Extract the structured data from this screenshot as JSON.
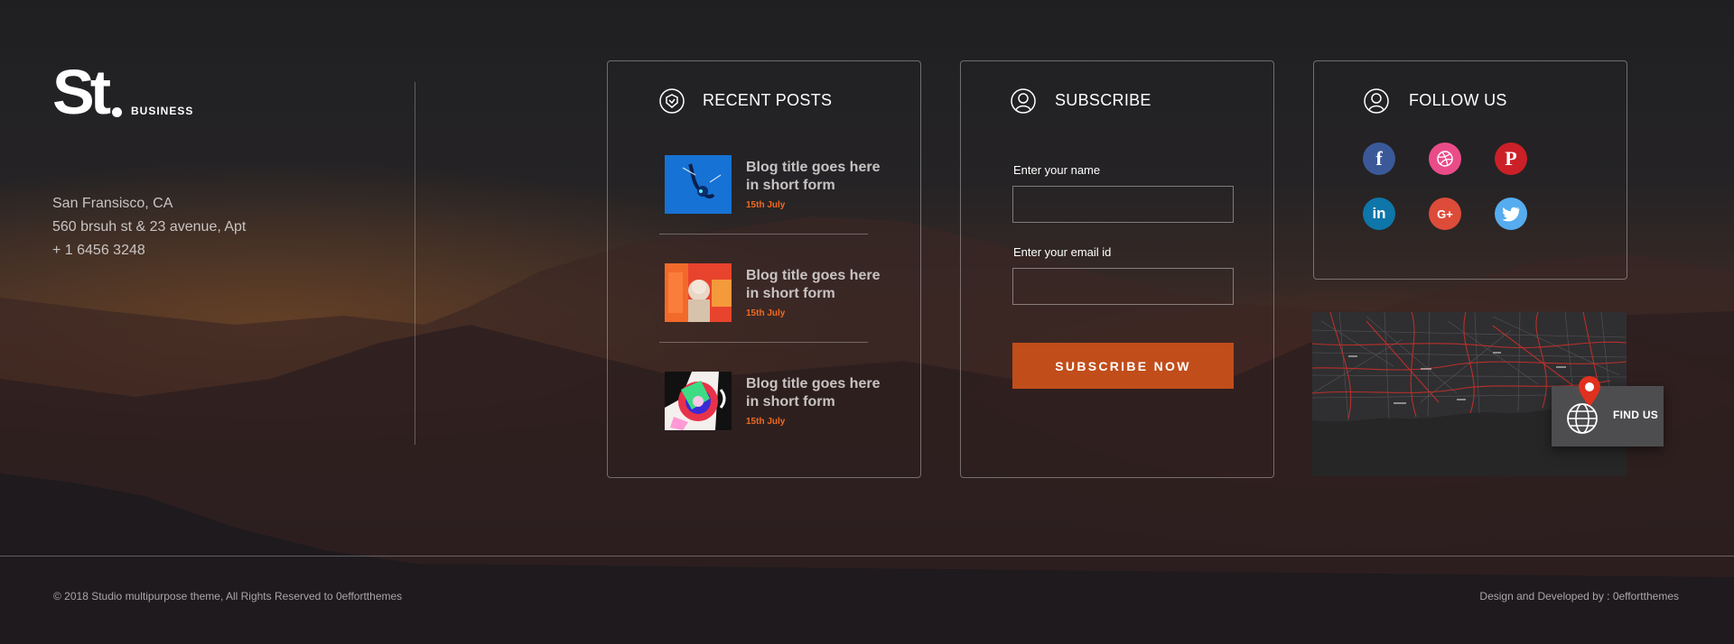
{
  "brand": {
    "logo": "St",
    "tagline": "BUSINESS"
  },
  "contact": {
    "city": "San Fransisco, CA",
    "street": "560 brsuh st & 23 avenue, Apt",
    "phone": "+ 1 6456 3248"
  },
  "recent_posts": {
    "title": "RECENT POSTS",
    "items": [
      {
        "title": "Blog title goes here in short form",
        "date": "15th July"
      },
      {
        "title": "Blog title goes here in short form",
        "date": "15th July"
      },
      {
        "title": "Blog title goes here in short form",
        "date": "15th July"
      }
    ]
  },
  "subscribe": {
    "title": "SUBSCRIBE",
    "name_label": "Enter your name",
    "name_value": "",
    "email_label": "Enter your email id",
    "email_value": "",
    "button_label": "SUBSCRIBE NOW"
  },
  "follow": {
    "title": "FOLLOW US",
    "networks": [
      {
        "name": "facebook",
        "glyph": "f",
        "color": "#3b5998"
      },
      {
        "name": "dribbble",
        "glyph": "",
        "color": "#ea4c89"
      },
      {
        "name": "pinterest",
        "glyph": "P",
        "color": "#cb2027"
      },
      {
        "name": "linkedin",
        "glyph": "in",
        "color": "#0e76a8"
      },
      {
        "name": "google-plus",
        "glyph": "G+",
        "color": "#dd4b39"
      },
      {
        "name": "twitter",
        "glyph": "",
        "color": "#55acee"
      }
    ]
  },
  "map": {
    "find_us_label": "FIND US"
  },
  "footer": {
    "copyright": "© 2018 Studio multipurpose theme,  All Rights Reserved to 0effortthemes",
    "credits": "Design and Developed by : 0effortthemes"
  },
  "colors": {
    "accent": "#c14d1b",
    "date": "#f06a22",
    "background": "#1f1f22"
  }
}
